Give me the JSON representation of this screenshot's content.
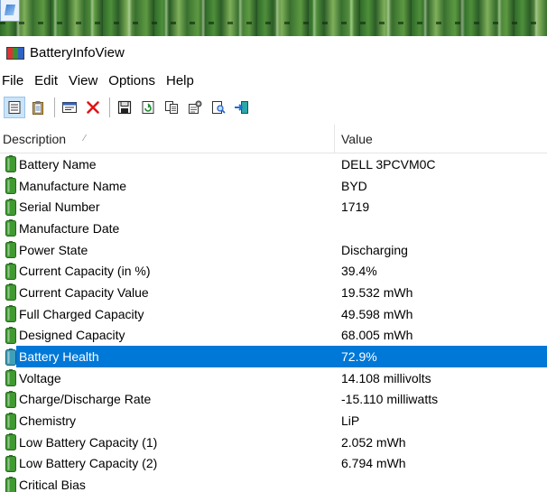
{
  "window": {
    "title": "BatteryInfoView"
  },
  "menu": [
    "File",
    "Edit",
    "View",
    "Options",
    "Help"
  ],
  "toolbar": {
    "buttons": [
      {
        "name": "properties-view-icon",
        "active": true
      },
      {
        "name": "clipboard-icon",
        "active": false
      },
      {
        "sep": true
      },
      {
        "name": "window-icon",
        "active": false
      },
      {
        "name": "delete-icon",
        "active": false
      },
      {
        "sep": true
      },
      {
        "name": "save-icon",
        "active": false
      },
      {
        "name": "refresh-icon",
        "active": false
      },
      {
        "name": "copy-icon",
        "active": false
      },
      {
        "name": "properties-icon",
        "active": false
      },
      {
        "name": "find-icon",
        "active": false
      },
      {
        "name": "exit-icon",
        "active": false
      }
    ]
  },
  "columns": {
    "description": "Description",
    "value": "Value"
  },
  "rows": [
    {
      "description": "Battery Name",
      "value": "DELL 3PCVM0C"
    },
    {
      "description": "Manufacture Name",
      "value": "BYD"
    },
    {
      "description": "Serial Number",
      "value": "1719"
    },
    {
      "description": "Manufacture Date",
      "value": ""
    },
    {
      "description": "Power State",
      "value": "Discharging"
    },
    {
      "description": "Current Capacity (in %)",
      "value": "39.4%"
    },
    {
      "description": "Current Capacity Value",
      "value": "19.532 mWh"
    },
    {
      "description": "Full Charged Capacity",
      "value": "49.598 mWh"
    },
    {
      "description": "Designed Capacity",
      "value": "68.005 mWh"
    },
    {
      "description": "Battery Health",
      "value": "72.9%",
      "selected": true
    },
    {
      "description": "Voltage",
      "value": "14.108 millivolts"
    },
    {
      "description": "Charge/Discharge Rate",
      "value": "-15.110 milliwatts"
    },
    {
      "description": "Chemistry",
      "value": "LiP"
    },
    {
      "description": "Low Battery Capacity (1)",
      "value": "2.052 mWh"
    },
    {
      "description": "Low Battery Capacity (2)",
      "value": "6.794 mWh"
    },
    {
      "description": "Critical Bias",
      "value": ""
    }
  ],
  "colors": {
    "selection": "#0078d7",
    "battery": "#3f9a2f"
  }
}
